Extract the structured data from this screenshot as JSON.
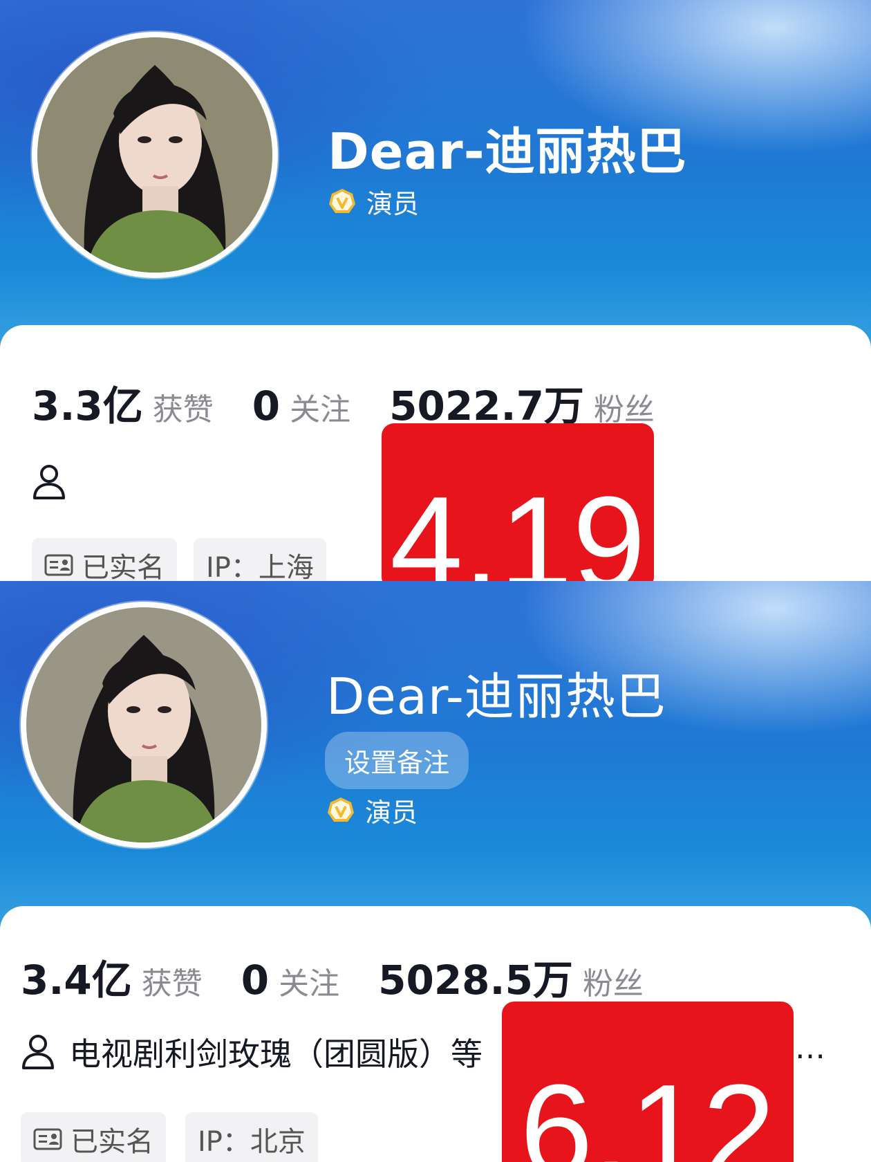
{
  "panel1": {
    "name": "Dear-迪丽热巴",
    "verified_label": "演员",
    "stats": [
      {
        "value": "3.3亿",
        "label": "获赞"
      },
      {
        "value": "0",
        "label": "关注"
      },
      {
        "value": "5022.7万",
        "label": "粉丝"
      }
    ],
    "tags": [
      "已实名",
      "IP：上海"
    ],
    "overlay_number": "4.19"
  },
  "panel2": {
    "name": "Dear-迪丽热巴",
    "note_button": "设置备注",
    "verified_label": "演员",
    "stats": [
      {
        "value": "3.4亿",
        "label": "获赞"
      },
      {
        "value": "0",
        "label": "关注"
      },
      {
        "value": "5028.5万",
        "label": "粉丝"
      }
    ],
    "bio": "电视剧利剑玫瑰（团圆版）等",
    "bio_more": "…",
    "tags": [
      "已实名",
      "IP：北京"
    ],
    "overlay_number": "6.12"
  },
  "colors": {
    "header_blue": "#1f79d4",
    "overlay_red": "#e8141c",
    "badge_gold": "#f5b82e"
  }
}
